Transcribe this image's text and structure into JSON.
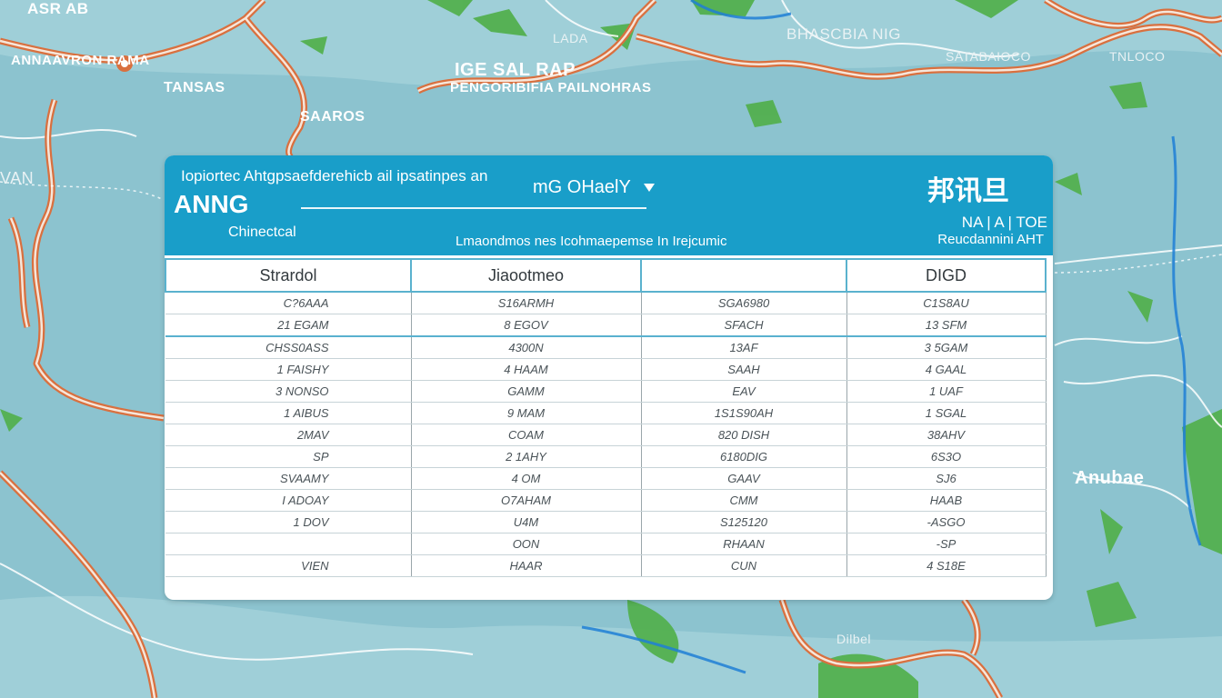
{
  "map": {
    "colors": {
      "water": "#8cc3cf",
      "land_green": "#4caf50",
      "road": "#d9703f",
      "river": "#1e88e5"
    },
    "labels": {
      "top_left_a": "ASR AB",
      "top_left_b": "ANNAAVRON RAMA",
      "top_left_c": "TANSAS",
      "top_left_d": "SAAROS",
      "top_center_a": "IGE SAL RAP",
      "top_center_b": "PENGORIBIFIA PAILNOHRAS",
      "top_center_c": "LADA",
      "top_right_a": "BHASCBIA NIG",
      "top_right_b": "SATABAIOCO",
      "top_right_c": "TNLOCO",
      "left_a": "VAN",
      "right_a": "Anubae",
      "bottom_a": "Dilbel"
    }
  },
  "panel": {
    "header": {
      "tagline": "Iopiortec Ahtgpsaefderehicb ail ipsatinpes an",
      "brand": "ANNG",
      "sub_brand": "Chinectcal",
      "center_title": "mG OHaelY",
      "center_subtitle": "Lmaondmos nes Icohmaepemse In Irejcumic",
      "right_title": "邦讯旦",
      "right_code": "NA | A | TOE",
      "right_sub": "Reucdannini AHT"
    },
    "table": {
      "headers": [
        "Strardol",
        "Jiaootmeo",
        "",
        "DIGD"
      ],
      "rows": [
        [
          "C?6AAA",
          "S16ARMH",
          "SGA6980",
          "C1S8AU"
        ],
        [
          "21 EGAM",
          "8 EGOV",
          "SFACH",
          "13 SFM"
        ],
        [
          "CHSS0ASS",
          "4300N",
          "13AF",
          "3 5GAM"
        ],
        [
          "1 FAISHY",
          "4 HAAM",
          "SAAH",
          "4 GAAL"
        ],
        [
          "3 NONSO",
          "GAMM",
          "EAV",
          "1 UAF"
        ],
        [
          "1 AIBUS",
          "9 MAM",
          "1S1S90AH",
          "1 SGAL"
        ],
        [
          "2MAV",
          "COAM",
          "820 DISH",
          "38AHV"
        ],
        [
          "SP",
          "2 1AHY",
          "6180DIG",
          "6S3O"
        ],
        [
          "SVAAMY",
          "4 OM",
          "GAAV",
          "SJ6"
        ],
        [
          "I ADOAY",
          "O7AHAM",
          "CMM",
          "HAAB"
        ],
        [
          "1 DOV",
          "U4M",
          "S125120",
          "-ASGO"
        ],
        [
          "",
          "OON",
          "RHAAN",
          "-SP"
        ],
        [
          "VIEN",
          "HAAR",
          "CUN",
          "4 S18E"
        ]
      ]
    }
  }
}
